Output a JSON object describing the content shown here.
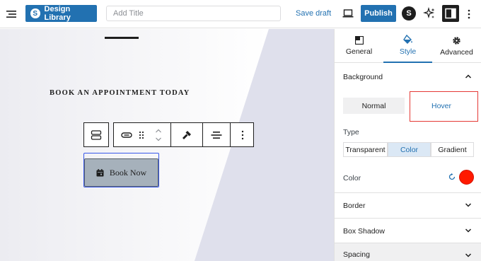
{
  "topbar": {
    "brand_label": "Design Library",
    "brand_logo_letter": "S",
    "title_placeholder": "Add Title",
    "title_value": "",
    "save_draft_label": "Save draft",
    "publish_label": "Publish",
    "account_logo_letter": "S"
  },
  "canvas": {
    "heading": "BOOK AN APPOINTMENT TODAY",
    "button_label": "Book Now",
    "button_icon": "calendar-icon",
    "button_color": "#a6b1bb"
  },
  "toolbar": {
    "icons": [
      "button-group-icon",
      "link-icon",
      "drag-handle-icon",
      "move-up-icon",
      "move-down-icon",
      "style-brush-icon",
      "align-icon",
      "more-options-icon"
    ]
  },
  "sidebar": {
    "tabs": [
      {
        "label": "General",
        "icon": "layout-icon",
        "active": false
      },
      {
        "label": "Style",
        "icon": "paint-bucket-icon",
        "active": true
      },
      {
        "label": "Advanced",
        "icon": "gear-icon",
        "active": false
      }
    ],
    "background": {
      "title": "Background",
      "expanded": true,
      "states": [
        "Normal",
        "Hover"
      ],
      "active_state": "Hover",
      "type_label": "Type",
      "type_options": [
        "Transparent",
        "Color",
        "Gradient"
      ],
      "type_selected": "Color",
      "color_label": "Color",
      "color_value": "#ff1a00"
    },
    "collapsed_sections": [
      "Border",
      "Box Shadow",
      "Spacing"
    ]
  },
  "colors": {
    "accent": "#2271b1",
    "highlight_box": "#e53935"
  }
}
